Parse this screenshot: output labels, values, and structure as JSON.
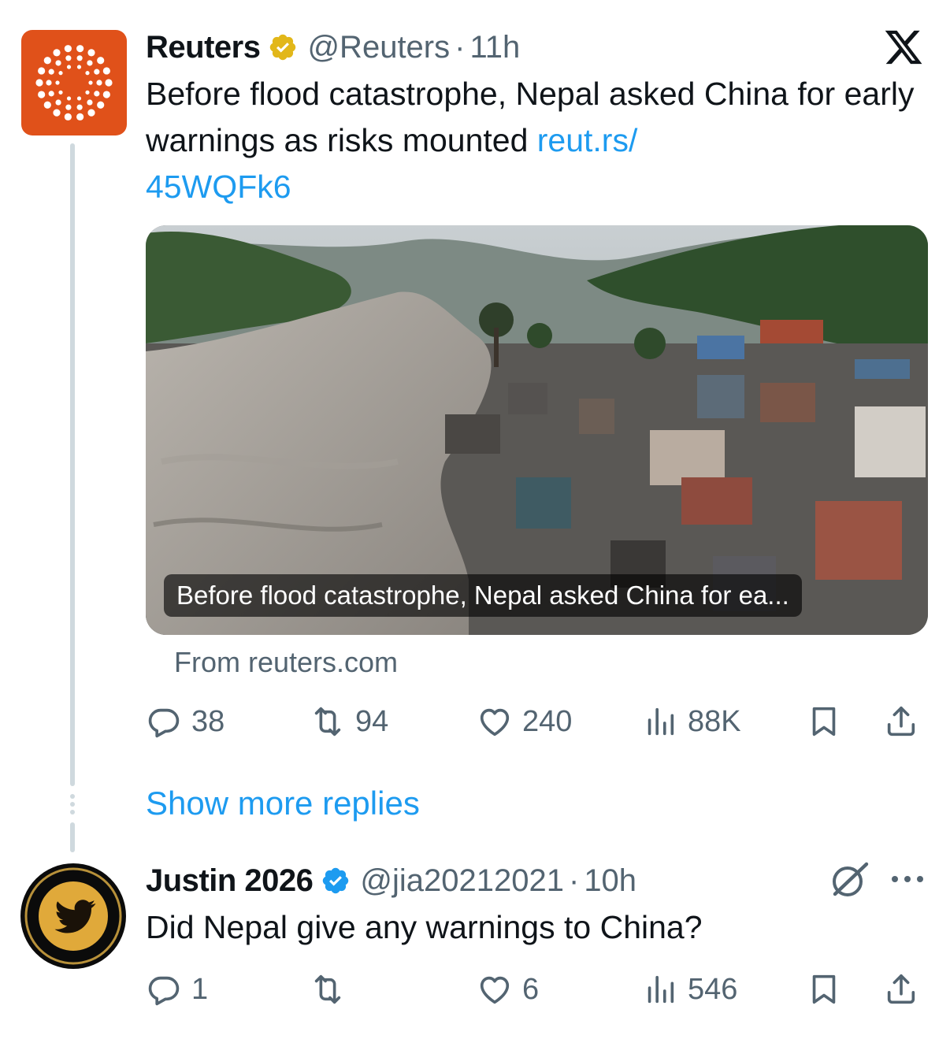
{
  "tweet": {
    "author_name": "Reuters",
    "author_handle": "@Reuters",
    "separator": "·",
    "time": "11h",
    "text": "Before flood catastrophe, Nepal asked China for early warnings as risks mounted ",
    "link_part1": "reut.rs/",
    "link_part2": "45WQFk6",
    "card_caption": "Before flood catastrophe, Nepal asked China for ea...",
    "card_source": "From reuters.com",
    "stats": {
      "replies": "38",
      "reposts": "94",
      "likes": "240",
      "views": "88K"
    },
    "verified_badge_color": "#e2b719",
    "avatar_color": "#e0511a"
  },
  "show_more_replies": "Show more replies",
  "reply": {
    "author_name": "Justin 2026",
    "author_handle": "@jia20212021",
    "separator": "·",
    "time": "10h",
    "text": "Did Nepal give any warnings to China?",
    "stats": {
      "replies": "1",
      "reposts": "",
      "likes": "6",
      "views": "546"
    },
    "verified_badge_color": "#1d9bf0"
  },
  "colors": {
    "link": "#1d9bf0",
    "secondary_text": "#536471",
    "thread_line": "#cfd9de"
  },
  "icons": [
    "x-logo-icon",
    "verified-badge-icon",
    "reply-icon",
    "repost-icon",
    "like-icon",
    "views-icon",
    "bookmark-icon",
    "share-icon",
    "grok-icon",
    "more-icon"
  ]
}
